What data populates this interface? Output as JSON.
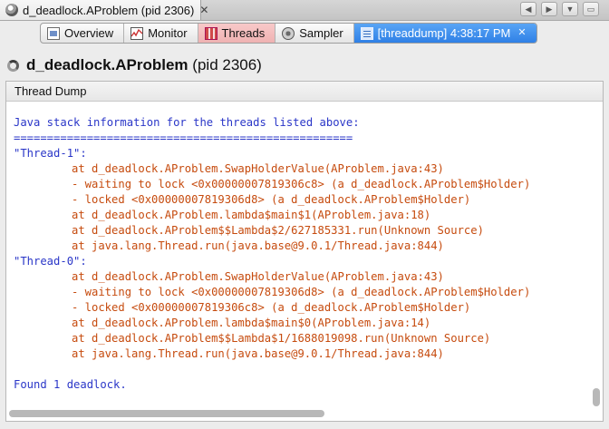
{
  "window": {
    "tab_title": "d_deadlock.AProblem (pid 2306)",
    "tab_close": "✕",
    "controls": {
      "left_arrow": "◀",
      "right_arrow": "▶",
      "menu": "▼",
      "maximize": "▭"
    }
  },
  "view_tabs": [
    {
      "label": "Overview",
      "icon": "overview-icon"
    },
    {
      "label": "Monitor",
      "icon": "monitor-icon"
    },
    {
      "label": "Threads",
      "icon": "threads-icon"
    },
    {
      "label": "Sampler",
      "icon": "sampler-icon"
    },
    {
      "label": "[threaddump] 4:38:17 PM",
      "icon": "thread-dump-icon",
      "close": "✕"
    }
  ],
  "header": {
    "app_name": "d_deadlock.AProblem",
    "pid_text": "(pid 2306)"
  },
  "panel": {
    "title": "Thread Dump",
    "lines": [
      {
        "text": "Java stack information for the threads listed above:",
        "style": "blue"
      },
      {
        "text": "===================================================",
        "style": "blue"
      },
      {
        "text": "\"Thread-1\":",
        "style": "blue"
      },
      {
        "text": "at d_deadlock.AProblem.SwapHolderValue(AProblem.java:43)",
        "style": "frame"
      },
      {
        "text": "- waiting to lock <0x00000007819306c8> (a d_deadlock.AProblem$Holder)",
        "style": "frame"
      },
      {
        "text": "- locked <0x00000007819306d8> (a d_deadlock.AProblem$Holder)",
        "style": "frame"
      },
      {
        "text": "at d_deadlock.AProblem.lambda$main$1(AProblem.java:18)",
        "style": "frame"
      },
      {
        "text": "at d_deadlock.AProblem$$Lambda$2/627185331.run(Unknown Source)",
        "style": "frame"
      },
      {
        "text": "at java.lang.Thread.run(java.base@9.0.1/Thread.java:844)",
        "style": "frame"
      },
      {
        "text": "\"Thread-0\":",
        "style": "blue"
      },
      {
        "text": "at d_deadlock.AProblem.SwapHolderValue(AProblem.java:43)",
        "style": "frame"
      },
      {
        "text": "- waiting to lock <0x00000007819306d8> (a d_deadlock.AProblem$Holder)",
        "style": "frame"
      },
      {
        "text": "- locked <0x00000007819306c8> (a d_deadlock.AProblem$Holder)",
        "style": "frame"
      },
      {
        "text": "at d_deadlock.AProblem.lambda$main$0(AProblem.java:14)",
        "style": "frame"
      },
      {
        "text": "at d_deadlock.AProblem$$Lambda$1/1688019098.run(Unknown Source)",
        "style": "frame"
      },
      {
        "text": "at java.lang.Thread.run(java.base@9.0.1/Thread.java:844)",
        "style": "frame"
      },
      {
        "text": "",
        "style": "blue"
      },
      {
        "text": "Found 1 deadlock.",
        "style": "blue"
      }
    ]
  },
  "colors": {
    "stack_frame_text": "#c64b0e",
    "info_text": "#2a36c8",
    "active_tab": "#2f80e6",
    "threads_tab": "#f0b8b8"
  }
}
